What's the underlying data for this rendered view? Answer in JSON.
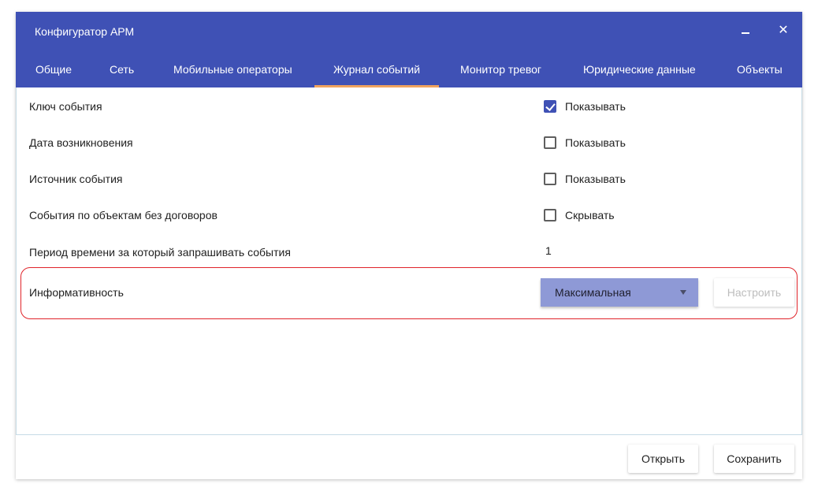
{
  "window": {
    "title": "Конфигуратор АРМ",
    "minimize_icon": "minimize-icon",
    "close_icon": "close-icon",
    "close_glyph": "✕"
  },
  "tabs": [
    {
      "label": "Общие",
      "active": false
    },
    {
      "label": "Сеть",
      "active": false
    },
    {
      "label": "Мобильные операторы",
      "active": false
    },
    {
      "label": "Журнал событий",
      "active": true
    },
    {
      "label": "Монитор тревог",
      "active": false
    },
    {
      "label": "Юридические данные",
      "active": false
    },
    {
      "label": "Объекты",
      "active": false
    }
  ],
  "settings": [
    {
      "label": "Ключ события",
      "control": "checkbox",
      "checked": true,
      "control_label": "Показывать"
    },
    {
      "label": "Дата возникновения",
      "control": "checkbox",
      "checked": false,
      "control_label": "Показывать"
    },
    {
      "label": "Источник события",
      "control": "checkbox",
      "checked": false,
      "control_label": "Показывать"
    },
    {
      "label": "События по объектам без договоров",
      "control": "checkbox",
      "checked": false,
      "control_label": "Скрывать"
    },
    {
      "label": "Период времени за который запрашивать события",
      "control": "value",
      "value": "1"
    },
    {
      "label": "Информативность",
      "control": "select",
      "value": "Максимальная",
      "button_label": "Настроить",
      "button_disabled": true
    }
  ],
  "footer": {
    "open_label": "Открыть",
    "save_label": "Сохранить"
  },
  "colors": {
    "header": "#3f51b5",
    "active_tab_underline": "#f0a35e",
    "select_background": "#8e99d6",
    "highlight_border": "#e0242a"
  }
}
